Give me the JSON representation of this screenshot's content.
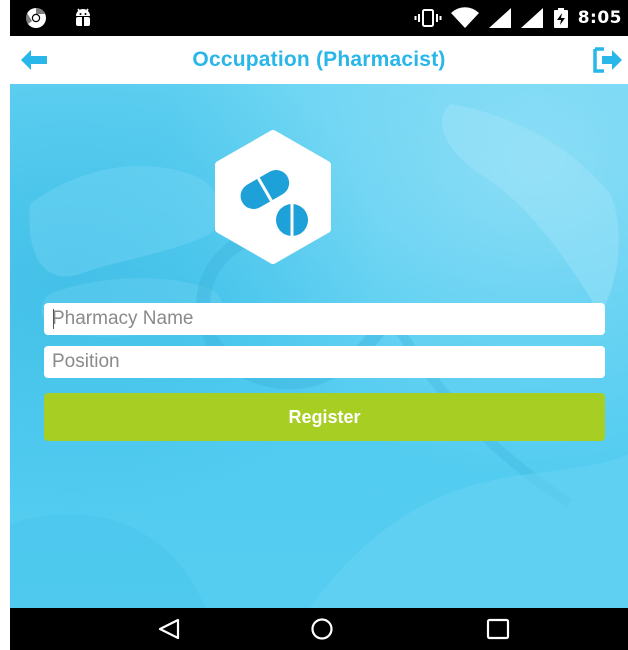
{
  "status_bar": {
    "time": "8:05",
    "icons": [
      "chrome-icon",
      "android-debug-icon",
      "vibrate-icon",
      "wifi-icon",
      "signal-icon",
      "signal-icon",
      "battery-charging-icon"
    ]
  },
  "header": {
    "title": "Occupation (Pharmacist)",
    "back_icon": "arrow-left-icon",
    "logout_icon": "logout-icon"
  },
  "form": {
    "logo_icon": "pills-icon",
    "pharmacy_name": {
      "value": "",
      "placeholder": "Pharmacy Name"
    },
    "position": {
      "value": "",
      "placeholder": "Position"
    },
    "register_label": "Register"
  },
  "nav_bar": {
    "icons": [
      "nav-back-icon",
      "nav-home-icon",
      "nav-recents-icon"
    ]
  },
  "colors": {
    "accent": "#29b6e8",
    "hero_background": "#4fcbf0",
    "register_button": "#a6ce23",
    "logo_pill": "#1ea1d8"
  }
}
